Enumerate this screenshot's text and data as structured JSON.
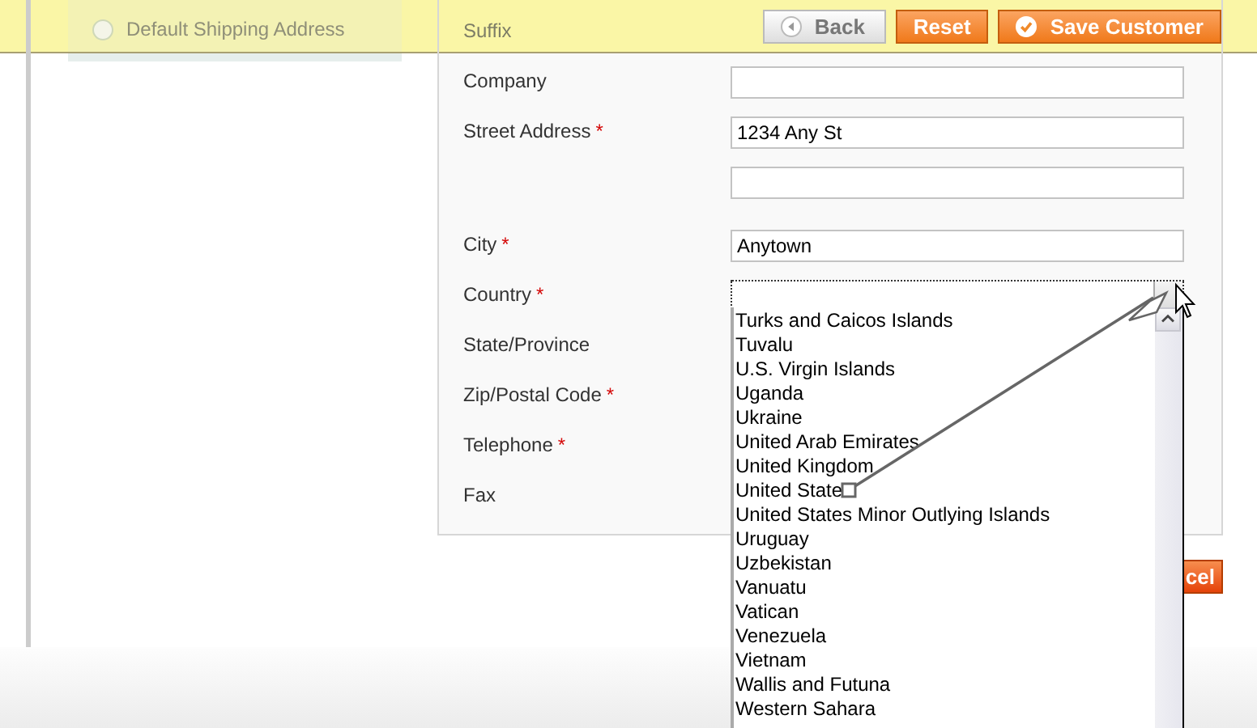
{
  "toolbar": {
    "buttons": [
      {
        "label": "Back",
        "kind": "back"
      },
      {
        "label": "Reset",
        "kind": "plain"
      },
      {
        "label": "Save Customer",
        "kind": "save"
      }
    ]
  },
  "address_options": [
    {
      "label": "Default Shipping Address",
      "selected": false
    }
  ],
  "form": {
    "fields": [
      {
        "label": "Suffix",
        "kind": "covered"
      },
      {
        "label": "Company",
        "kind": "text"
      },
      {
        "label": "Street Address",
        "required_mark": "*",
        "kind": "text",
        "value": "1234 Any St"
      },
      {
        "kind": "text"
      },
      {
        "label": "City",
        "required_mark": "*",
        "kind": "text",
        "value": "Anytown"
      },
      {
        "label": "Country",
        "required_mark": "*",
        "kind": "select",
        "focused": true
      },
      {
        "label": "State/Province",
        "kind": "covered"
      },
      {
        "label": "Zip/Postal Code",
        "required_mark": "*",
        "kind": "covered"
      },
      {
        "label": "Telephone",
        "required_mark": "*",
        "kind": "covered"
      },
      {
        "label": "Fax",
        "kind": "covered"
      }
    ]
  },
  "cancel_button": {
    "label": "cel"
  },
  "country_list": {
    "options": [
      "Turks and Caicos Islands",
      "Tuvalu",
      "U.S. Virgin Islands",
      "Uganda",
      "Ukraine",
      "United Arab Emirates",
      "United Kingdom",
      "United State",
      "United States Minor Outlying Islands",
      "Uruguay",
      "Uzbekistan",
      "Vanuatu",
      "Vatican",
      "Venezuela",
      "Vietnam",
      "Wallis and Futuna",
      "Western Sahara"
    ]
  }
}
